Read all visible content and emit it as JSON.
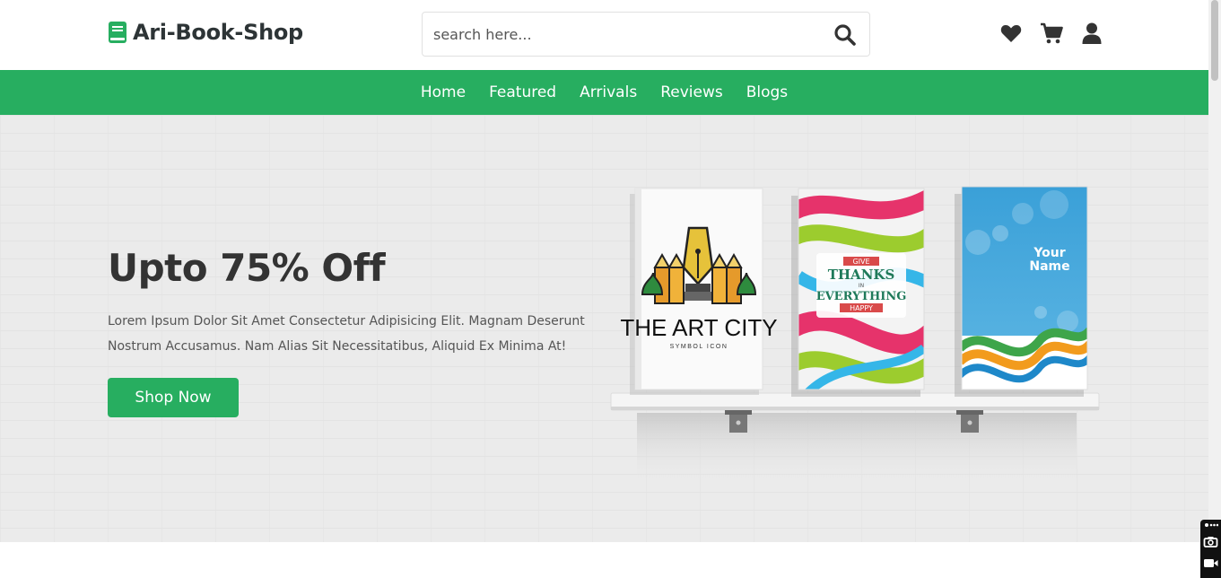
{
  "header": {
    "brand": "Ari-Book-Shop",
    "search_placeholder": "search here..."
  },
  "icons": {
    "logo": "book-icon",
    "search": "search-icon",
    "wishlist": "heart-icon",
    "cart": "cart-icon",
    "account": "user-icon"
  },
  "nav": {
    "items": [
      "Home",
      "Featured",
      "Arrivals",
      "Reviews",
      "Blogs"
    ]
  },
  "hero": {
    "headline": "Upto 75% Off",
    "description": "Lorem Ipsum Dolor Sit Amet Consectetur Adipisicing Elit. Magnam Deserunt Nostrum Accusamus. Nam Alias Sit Necessitatibus, Aliquid Ex Minima At!",
    "cta": "Shop Now"
  },
  "books": [
    {
      "title": "THE ART CITY",
      "subtitle": "SYMBOL ICON"
    },
    {
      "lines": [
        "GIVE",
        "THANKS",
        "IN",
        "EVERYTHING",
        "HAPPY"
      ]
    },
    {
      "lines": [
        "Your",
        "Name"
      ]
    }
  ],
  "colors": {
    "accent": "#27ae60",
    "text_dark": "#333333"
  }
}
